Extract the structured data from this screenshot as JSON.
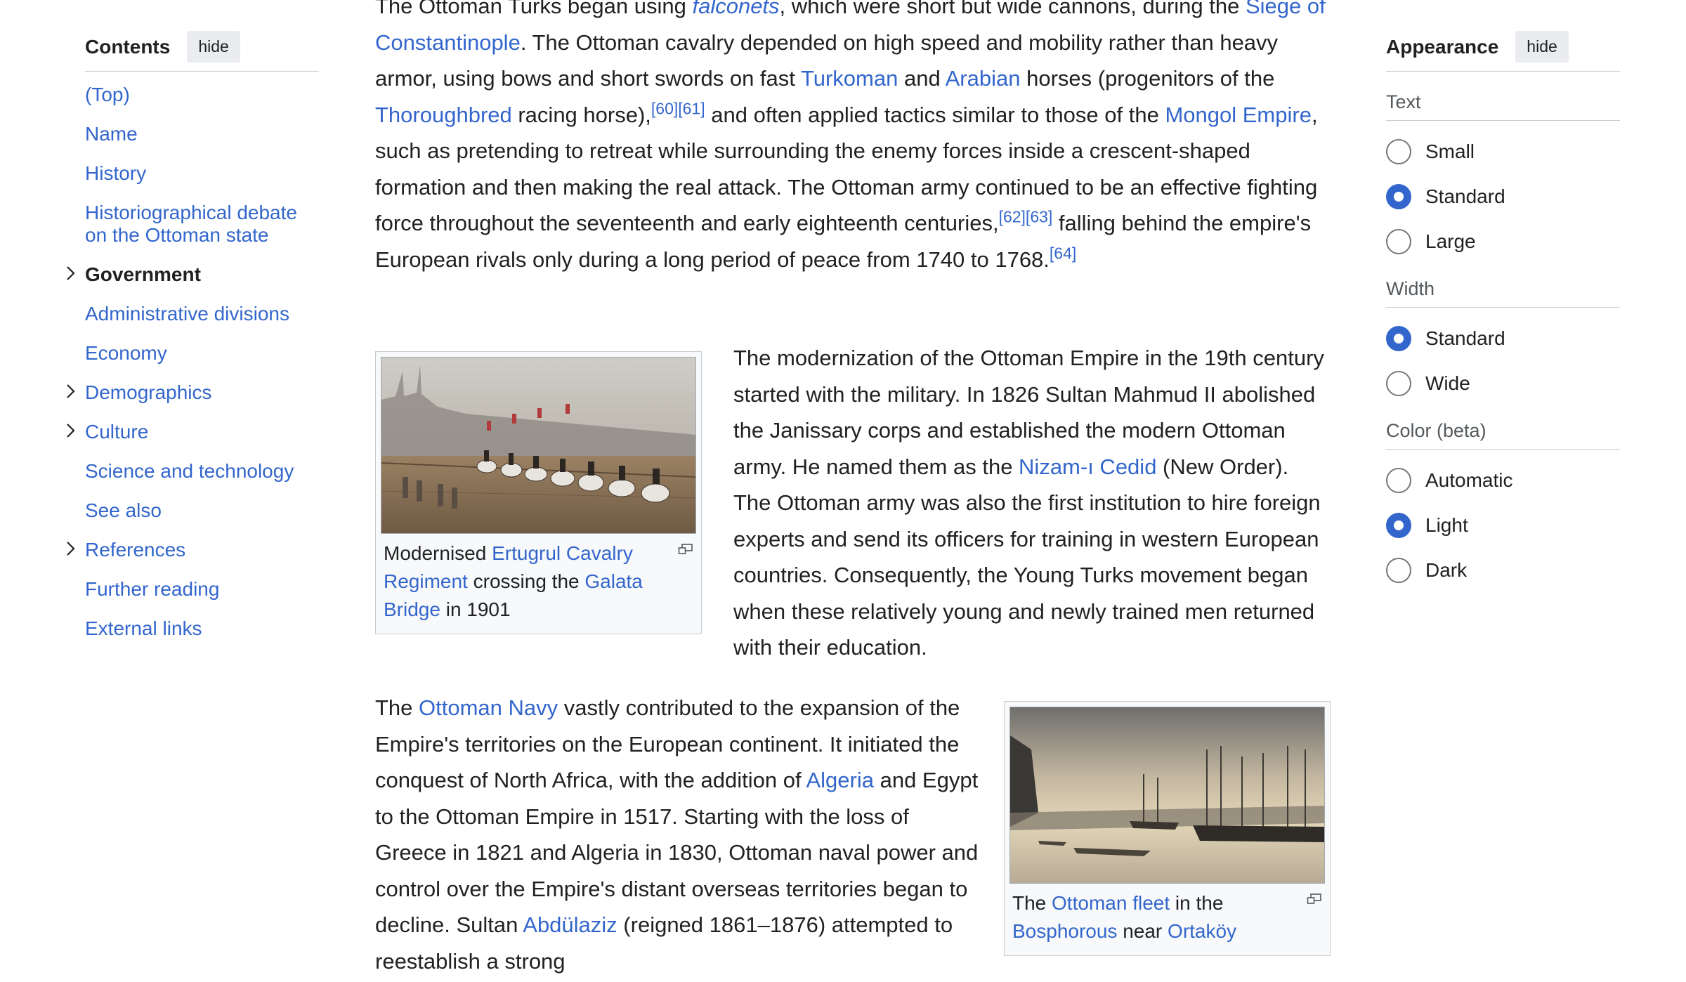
{
  "toc": {
    "title": "Contents",
    "hide_label": "hide",
    "items": [
      {
        "label": "(Top)"
      },
      {
        "label": "Name"
      },
      {
        "label": "History"
      },
      {
        "label": "Historiographical debate on the Ottoman state"
      },
      {
        "label": "Government"
      },
      {
        "label": "Administrative divisions"
      },
      {
        "label": "Economy"
      },
      {
        "label": "Demographics"
      },
      {
        "label": "Culture"
      },
      {
        "label": "Science and technology"
      },
      {
        "label": "See also"
      },
      {
        "label": "References"
      },
      {
        "label": "Further reading"
      },
      {
        "label": "External links"
      }
    ]
  },
  "article": {
    "p1": {
      "t1": "The Ottoman Turks began using ",
      "l1": "falconets",
      "t2": ", which were short but wide cannons, during the ",
      "l2": "Siege of Constantinople",
      "t3": ". The Ottoman cavalry depended on high speed and mobility rather than heavy armor, using bows and short swords on fast ",
      "l3": "Turkoman",
      "t4": " and ",
      "l4": "Arabian",
      "t5": " horses (progenitors of the ",
      "l5": "Thoroughbred",
      "t6": " racing horse),",
      "r1": "[60][61]",
      "t7": " and often applied tactics similar to those of the ",
      "l6": "Mongol Empire",
      "t8": ", such as pretending to retreat while surrounding the enemy forces inside a crescent-shaped formation and then making the real attack. The Ottoman army continued to be an effective fighting force throughout the seventeenth and early eighteenth centuries,",
      "r2": "[62][63]",
      "t9": " falling behind the empire's European rivals only during a long period of peace from 1740 to 1768.",
      "r3": "[64]"
    },
    "figure1": {
      "c1": "Modernised ",
      "l1": "Ertugrul Cavalry Regiment",
      "c2": " crossing the ",
      "l2": "Galata Bridge",
      "c3": " in 1901"
    },
    "p2": {
      "t1": "The modernization of the Ottoman Empire in the 19th century started with the military. In 1826 Sultan Mahmud II abolished the Janissary corps and established the modern Ottoman army. He named them as the ",
      "l1": "Nizam-ı Cedid",
      "t2": " (New Order). The Ottoman army was also the first institution to hire foreign experts and send its officers for training in western European countries. Consequently, the Young Turks movement began when these relatively young and newly trained men returned with their education."
    },
    "p3": {
      "t1": "The ",
      "l1": "Ottoman Navy",
      "t2": " vastly contributed to the expansion of the Empire's territories on the European continent. It initiated the conquest of North Africa, with the addition of ",
      "l2": "Algeria",
      "t3": " and Egypt to the Ottoman Empire in 1517. Starting with the loss of Greece in 1821 and Algeria in 1830, Ottoman naval power and control over the Empire's distant overseas territories began to decline. Sultan ",
      "l3": "Abdülaziz",
      "t4": " (reigned 1861–1876) attempted to reestablish a strong"
    },
    "figure2": {
      "c1": "The ",
      "l1": "Ottoman fleet",
      "c2": " in the ",
      "l2": "Bosphorous",
      "c3": " near ",
      "l3": "Ortaköy"
    }
  },
  "appearance": {
    "title": "Appearance",
    "hide_label": "hide",
    "text_label": "Text",
    "text_options": [
      "Small",
      "Standard",
      "Large"
    ],
    "text_selected": "Standard",
    "width_label": "Width",
    "width_options": [
      "Standard",
      "Wide"
    ],
    "width_selected": "Standard",
    "color_label": "Color (beta)",
    "color_options": [
      "Automatic",
      "Light",
      "Dark"
    ],
    "color_selected": "Light",
    "accent_color": "#3366cc",
    "link_color": "#3366cc"
  }
}
